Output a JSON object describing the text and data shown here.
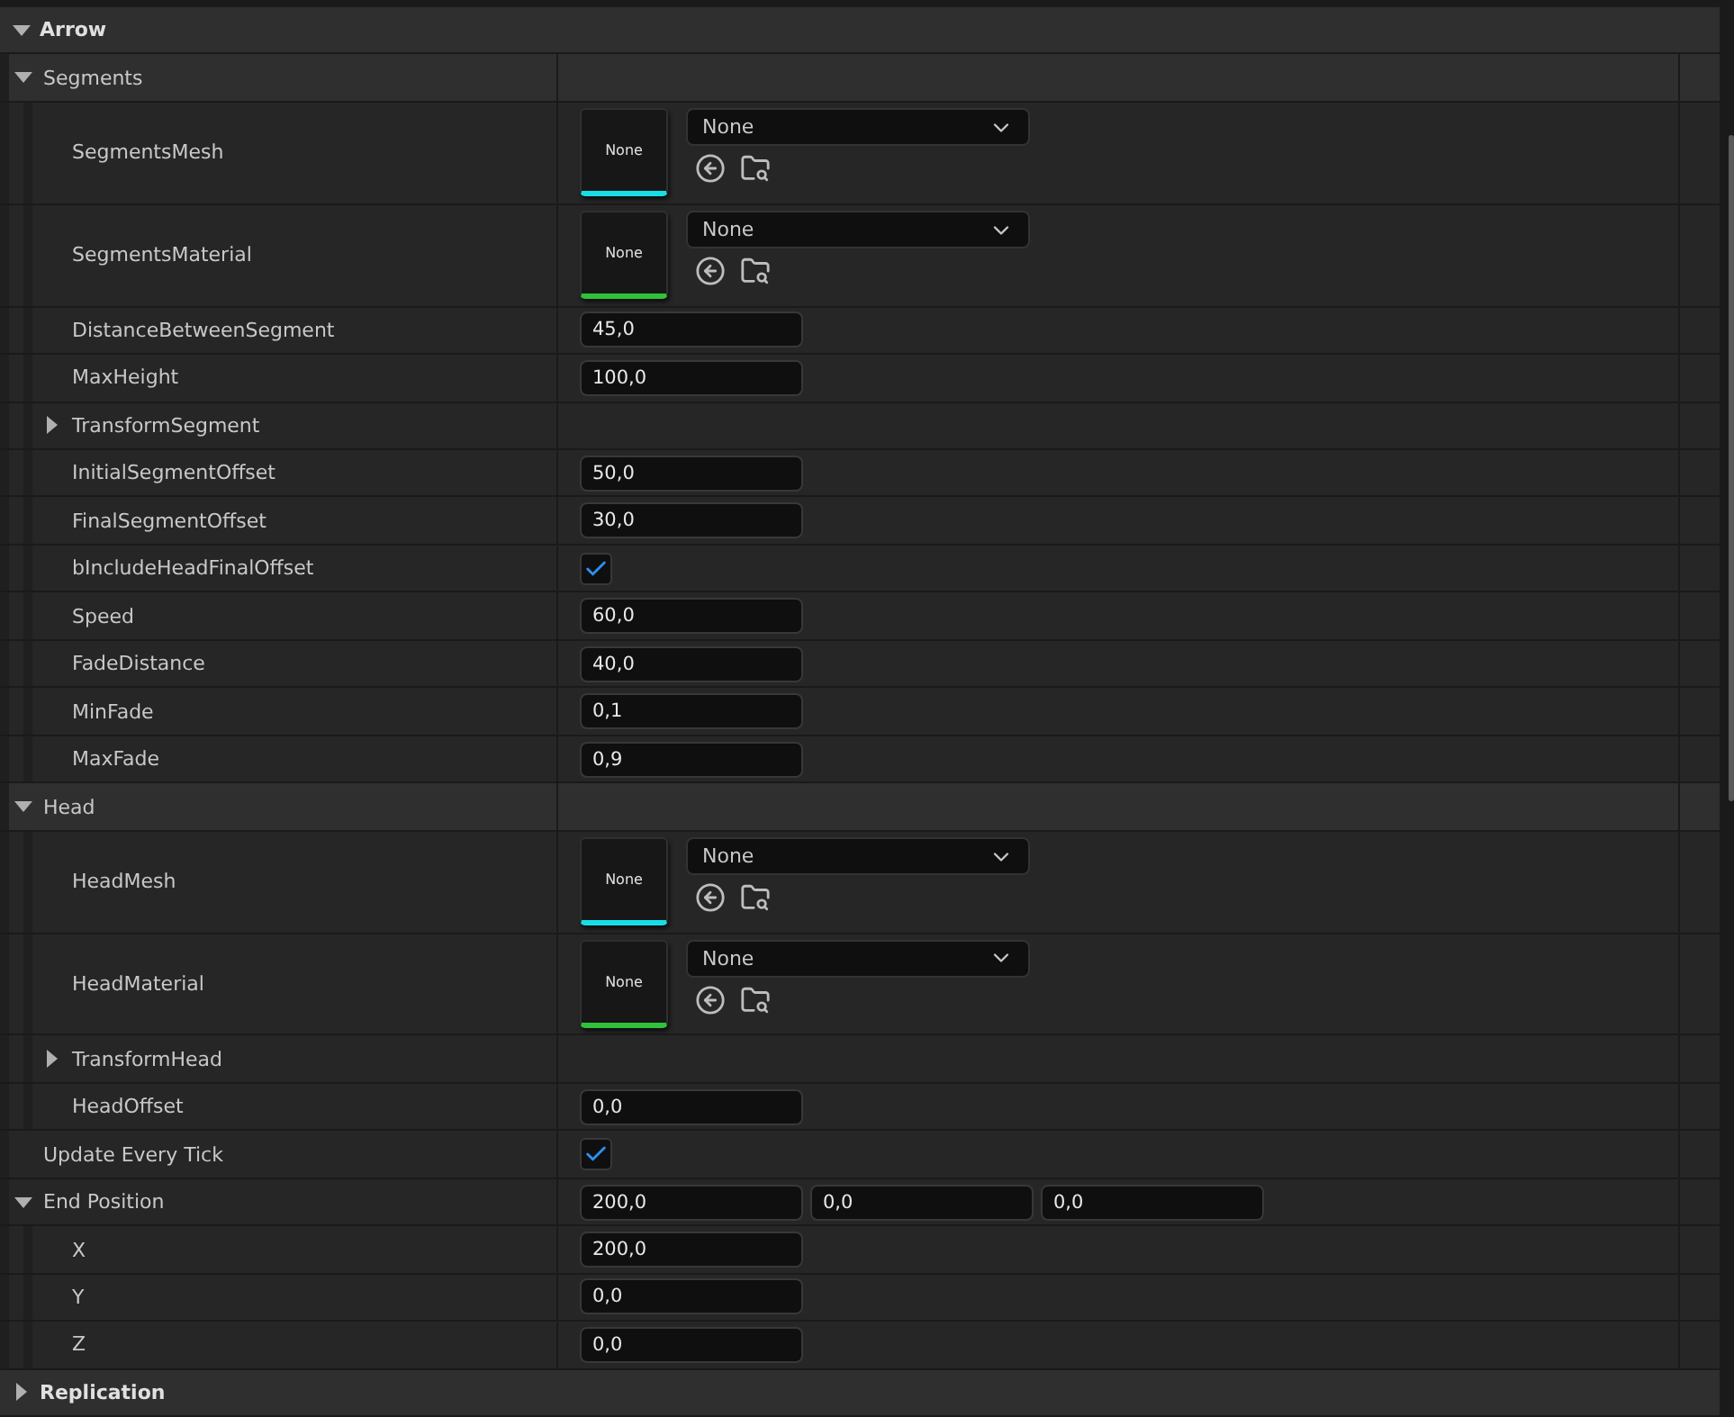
{
  "categories": [
    {
      "label": "Arrow",
      "expanded": true,
      "children": [
        {
          "kind": "group",
          "label": "Segments",
          "expanded": true,
          "children": [
            {
              "kind": "asset",
              "label": "SegmentsMesh",
              "thumbnail": "None",
              "value": "None",
              "color": "#19dde6"
            },
            {
              "kind": "asset",
              "label": "SegmentsMaterial",
              "thumbnail": "None",
              "value": "None",
              "color": "#2fc23a"
            },
            {
              "kind": "number",
              "label": "DistanceBetweenSegment",
              "value": "45,0"
            },
            {
              "kind": "number",
              "label": "MaxHeight",
              "value": "100,0"
            },
            {
              "kind": "group",
              "label": "TransformSegment",
              "expanded": false
            },
            {
              "kind": "number",
              "label": "InitialSegmentOffset",
              "value": "50,0"
            },
            {
              "kind": "number",
              "label": "FinalSegmentOffset",
              "value": "30,0"
            },
            {
              "kind": "checkbox",
              "label": "bIncludeHeadFinalOffset",
              "checked": true
            },
            {
              "kind": "number",
              "label": "Speed",
              "value": "60,0"
            },
            {
              "kind": "number",
              "label": "FadeDistance",
              "value": "40,0"
            },
            {
              "kind": "number",
              "label": "MinFade",
              "value": "0,1"
            },
            {
              "kind": "number",
              "label": "MaxFade",
              "value": "0,9"
            }
          ]
        },
        {
          "kind": "group",
          "label": "Head",
          "expanded": true,
          "children": [
            {
              "kind": "asset",
              "label": "HeadMesh",
              "thumbnail": "None",
              "value": "None",
              "color": "#19dde6"
            },
            {
              "kind": "asset",
              "label": "HeadMaterial",
              "thumbnail": "None",
              "value": "None",
              "color": "#2fc23a"
            },
            {
              "kind": "group",
              "label": "TransformHead",
              "expanded": false
            },
            {
              "kind": "number",
              "label": "HeadOffset",
              "value": "0,0"
            }
          ]
        },
        {
          "kind": "checkbox",
          "label": "Update Every Tick",
          "checked": true
        },
        {
          "kind": "vector",
          "label": "End Position",
          "expanded": true,
          "values": [
            "200,0",
            "0,0",
            "0,0"
          ],
          "children": [
            {
              "kind": "number",
              "label": "X",
              "value": "200,0"
            },
            {
              "kind": "number",
              "label": "Y",
              "value": "0,0"
            },
            {
              "kind": "number",
              "label": "Z",
              "value": "0,0"
            }
          ]
        }
      ]
    },
    {
      "label": "Replication",
      "expanded": false
    }
  ]
}
